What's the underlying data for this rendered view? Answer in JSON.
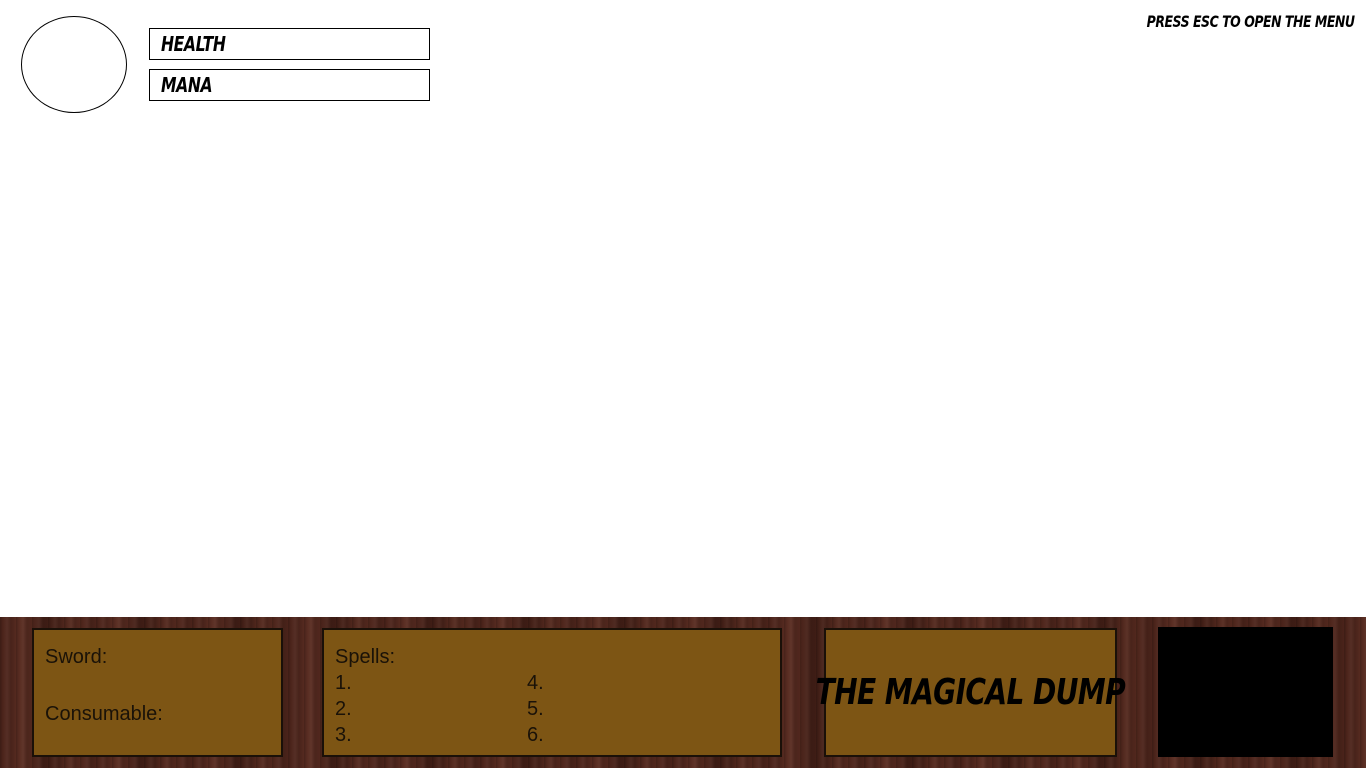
{
  "hud": {
    "health_label": "Health",
    "mana_label": "Mana",
    "esc_hint": "Press ESC to open the menu"
  },
  "equipment": {
    "sword_label": "Sword:",
    "consumable_label": "Consumable:"
  },
  "spells": {
    "header": "Spells:",
    "slots": [
      "1.",
      "2.",
      "3.",
      "4.",
      "5.",
      "6."
    ]
  },
  "title_panel": {
    "game_title": "The Magical Dump"
  },
  "colors": {
    "panel_fill": "#7d5514",
    "wood_dark": "#4a231a",
    "minimap_bg": "#000000"
  }
}
